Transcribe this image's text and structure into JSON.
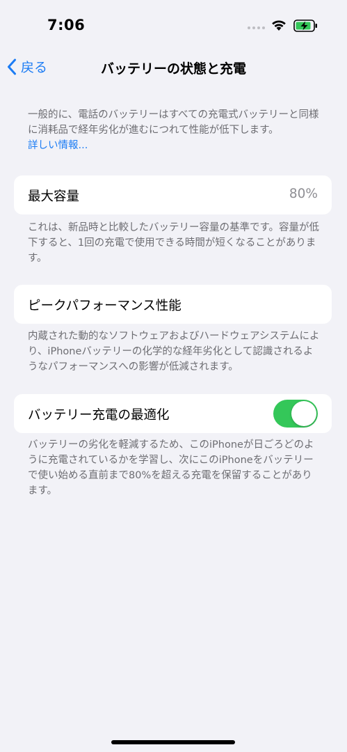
{
  "status_bar": {
    "time": "7:06"
  },
  "nav": {
    "back_label": "戻る",
    "title": "バッテリーの状態と充電"
  },
  "intro": {
    "text": "一般的に、電話のバッテリーはすべての充電式バッテリーと同様に消耗品で経年劣化が進むにつれて性能が低下します。",
    "link": "詳しい情報..."
  },
  "max_capacity": {
    "label": "最大容量",
    "value": "80%",
    "description": "これは、新品時と比較したバッテリー容量の基準です。容量が低下すると、1回の充電で使用できる時間が短くなることがあります。"
  },
  "peak_performance": {
    "label": "ピークパフォーマンス性能",
    "description": "内蔵された動的なソフトウェアおよびハードウェアシステムにより、iPhoneバッテリーの化学的な経年劣化として認識されるようなパフォーマンスへの影響が低減されます。"
  },
  "optimized_charging": {
    "label": "バッテリー充電の最適化",
    "enabled": true,
    "description": "バッテリーの劣化を軽減するため、このiPhoneが日ごろどのように充電されているかを学習し、次にこのiPhoneをバッテリーで使い始める直前まで80%を超える充電を保留することがあります。"
  },
  "colors": {
    "background": "#F2F2F7",
    "accent": "#1C7CF4",
    "toggle_on": "#34C759",
    "secondary_text": "#6D6D72",
    "value_text": "#8E8E93"
  }
}
